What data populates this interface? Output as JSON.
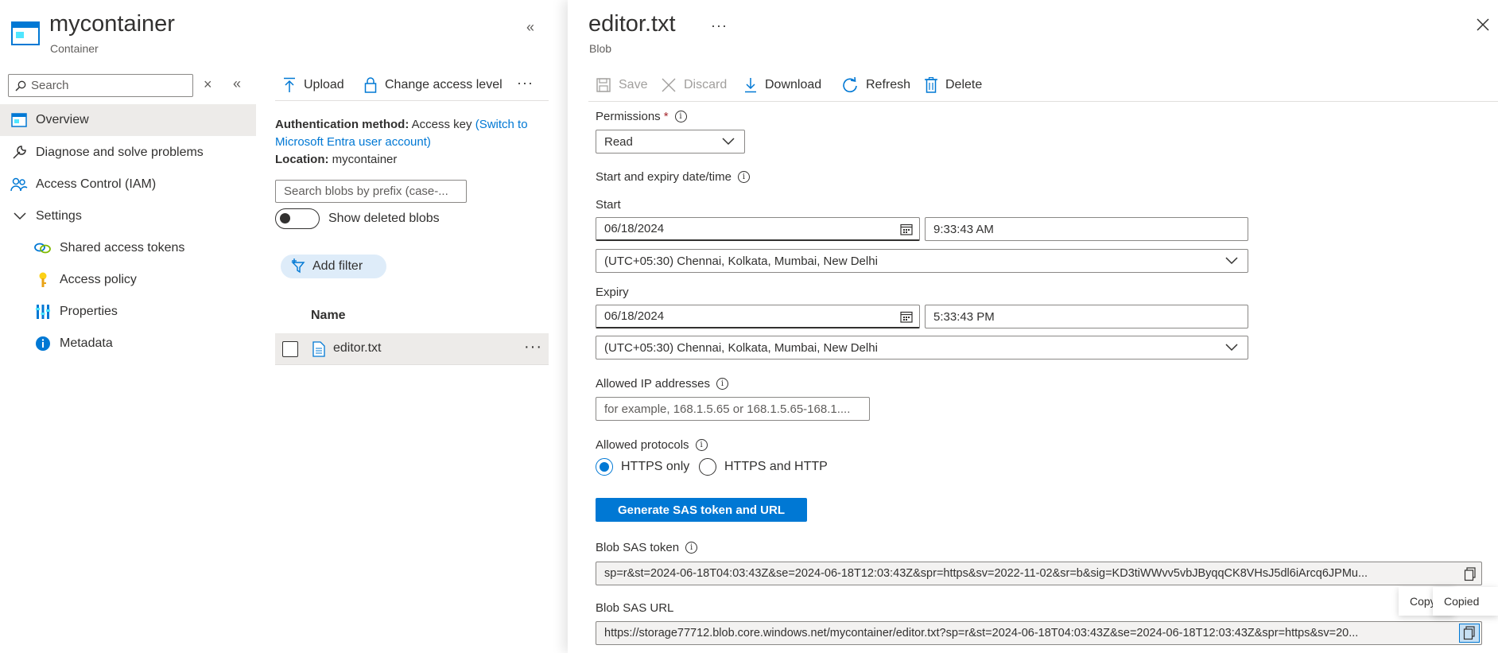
{
  "left_panel": {
    "title": "mycontainer",
    "subtitle": "Container",
    "search_placeholder": "Search",
    "nav": [
      {
        "label": "Overview",
        "icon": "overview-icon",
        "active": true
      },
      {
        "label": "Diagnose and solve problems",
        "icon": "wrench-icon"
      },
      {
        "label": "Access Control (IAM)",
        "icon": "people-icon"
      },
      {
        "label": "Settings",
        "icon": "chevron-down-icon"
      },
      {
        "label": "Shared access tokens",
        "icon": "link-icon"
      },
      {
        "label": "Access policy",
        "icon": "key-icon"
      },
      {
        "label": "Properties",
        "icon": "properties-icon"
      },
      {
        "label": "Metadata",
        "icon": "info-icon"
      }
    ]
  },
  "middle_panel": {
    "toolbar": {
      "upload": "Upload",
      "change_access": "Change access level"
    },
    "auth_label": "Authentication method:",
    "auth_value": "Access key",
    "auth_link_1": "(Switch to",
    "auth_link_2": "Microsoft Entra user account)",
    "location_label": "Location:",
    "location_value": "mycontainer",
    "search_placeholder": "Search blobs by prefix (case-...",
    "show_deleted": "Show deleted blobs",
    "add_filter": "Add filter",
    "column_name": "Name",
    "rows": [
      {
        "name": "editor.txt"
      }
    ]
  },
  "blade": {
    "title": "editor.txt",
    "subtitle": "Blob",
    "toolbar": {
      "save": "Save",
      "discard": "Discard",
      "download": "Download",
      "refresh": "Refresh",
      "delete": "Delete"
    },
    "permissions_label": "Permissions",
    "permissions_value": "Read",
    "start_expiry_label": "Start and expiry date/time",
    "start_label": "Start",
    "start_date": "06/18/2024",
    "start_time": "9:33:43 AM",
    "start_tz": "(UTC+05:30) Chennai, Kolkata, Mumbai, New Delhi",
    "expiry_label": "Expiry",
    "expiry_date": "06/18/2024",
    "expiry_time": "5:33:43 PM",
    "expiry_tz": "(UTC+05:30) Chennai, Kolkata, Mumbai, New Delhi",
    "allowed_ip_label": "Allowed IP addresses",
    "allowed_ip_placeholder": "for example, 168.1.5.65 or 168.1.5.65-168.1....",
    "protocols_label": "Allowed protocols",
    "protocol_https": "HTTPS only",
    "protocol_both": "HTTPS and HTTP",
    "generate_button": "Generate SAS token and URL",
    "sas_token_label": "Blob SAS token",
    "sas_token_value": "sp=r&st=2024-06-18T04:03:43Z&se=2024-06-18T12:03:43Z&spr=https&sv=2022-11-02&sr=b&sig=KD3tiWWvv5vbJByqqCK8VHsJ5dl6iArcq6JPMu...",
    "sas_url_label": "Blob SAS URL",
    "sas_url_value": "https://storage77712.blob.core.windows.net/mycontainer/editor.txt?sp=r&st=2024-06-18T04:03:43Z&se=2024-06-18T12:03:43Z&spr=https&sv=20...",
    "tooltip_back": "Copy",
    "tooltip": "Copied"
  },
  "colors": {
    "accent": "#0078d4",
    "link": "#0078d4",
    "nav_active": "#edebe9"
  }
}
